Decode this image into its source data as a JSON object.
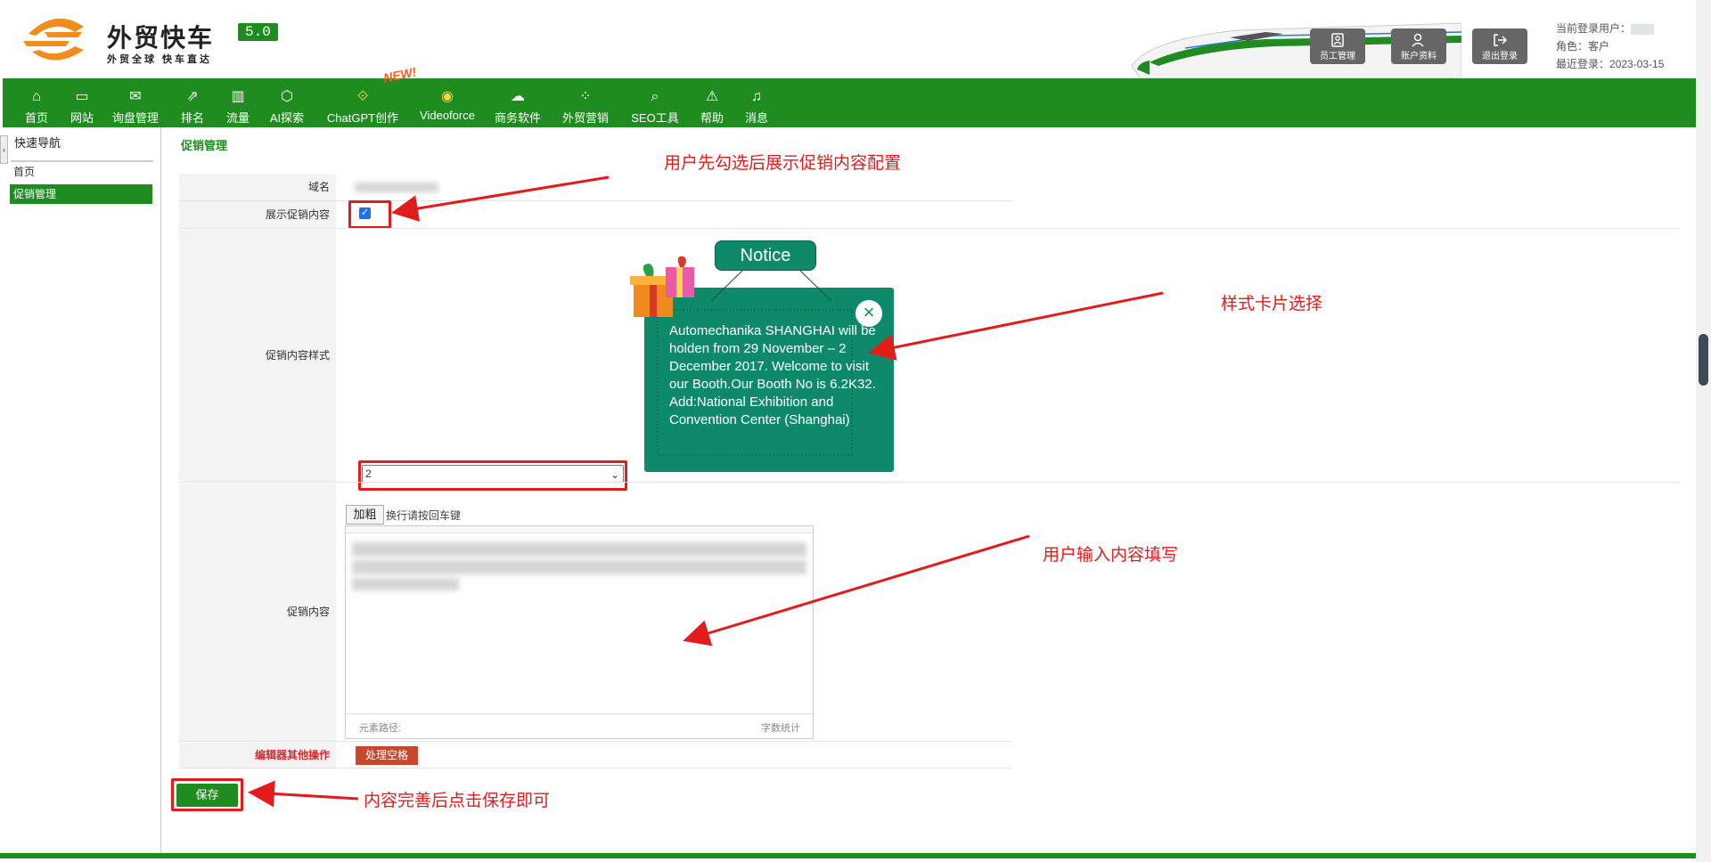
{
  "header": {
    "logo_title": "外贸快车",
    "logo_version": "5.0",
    "logo_subtitle": "外贸全球 快车直达",
    "buttons": [
      {
        "label": "员工管理",
        "icon": "staff-icon"
      },
      {
        "label": "账户资料",
        "icon": "account-icon"
      },
      {
        "label": "退出登录",
        "icon": "logout-icon"
      }
    ],
    "user": {
      "current_user_label": "当前登录用户：",
      "role_label": "角色：",
      "role_value": "客户",
      "last_login_label": "最近登录：",
      "last_login_value": "2023-03-15"
    }
  },
  "nav": {
    "new_badge": "NEW!",
    "items": [
      {
        "label": "首页",
        "icon": "home-icon"
      },
      {
        "label": "网站",
        "icon": "monitor-icon"
      },
      {
        "label": "询盘管理",
        "icon": "mail-icon"
      },
      {
        "label": "排名",
        "icon": "ranking-icon"
      },
      {
        "label": "流量",
        "icon": "bar-chart-icon"
      },
      {
        "label": "AI探索",
        "icon": "ai-icon"
      },
      {
        "label": "ChatGPT创作",
        "icon": "chatgpt-icon"
      },
      {
        "label": "Videoforce",
        "icon": "video-icon"
      },
      {
        "label": "商务软件",
        "icon": "software-icon"
      },
      {
        "label": "外贸营销",
        "icon": "marketing-icon"
      },
      {
        "label": "SEO工具",
        "icon": "search-icon"
      },
      {
        "label": "帮助",
        "icon": "help-icon"
      },
      {
        "label": "消息",
        "icon": "bell-icon"
      }
    ]
  },
  "sidebar": {
    "title": "快速导航",
    "items": [
      {
        "label": "首页"
      },
      {
        "label": "促销管理",
        "active": true
      }
    ]
  },
  "main": {
    "page_title": "促销管理",
    "form": {
      "domain_label": "域名",
      "show_promo_label": "展示促销内容",
      "show_promo_checked": true,
      "style_label": "促销内容样式",
      "style_selected": "2",
      "content_label": "促销内容",
      "bold_button": "加粗",
      "editor_hint": "换行请按回车键",
      "editor_path_label": "元素路径:",
      "editor_count_label": "字数统计",
      "other_ops_label": "编辑器其他操作",
      "process_space_button": "处理空格",
      "save_button": "保存"
    },
    "card": {
      "tag": "Notice",
      "close": "×",
      "text": "Automechanika SHANGHAI will be holden from 29 November – 2 December 2017. Welcome to visit our Booth.Our Booth No is 6.2K32. Add:National Exhibition and Convention Center (Shanghai)"
    }
  },
  "annotations": {
    "step1": "用户先勾选后展示促销内容配置",
    "step2": "样式卡片选择",
    "step3": "用户输入内容填写",
    "step4": "内容完善后点击保存即可"
  },
  "colors": {
    "brand_green": "#1e8c1e",
    "card_teal": "#0e8a6b",
    "annotation_red": "#e21b1b",
    "button_orange": "#c8472d"
  }
}
